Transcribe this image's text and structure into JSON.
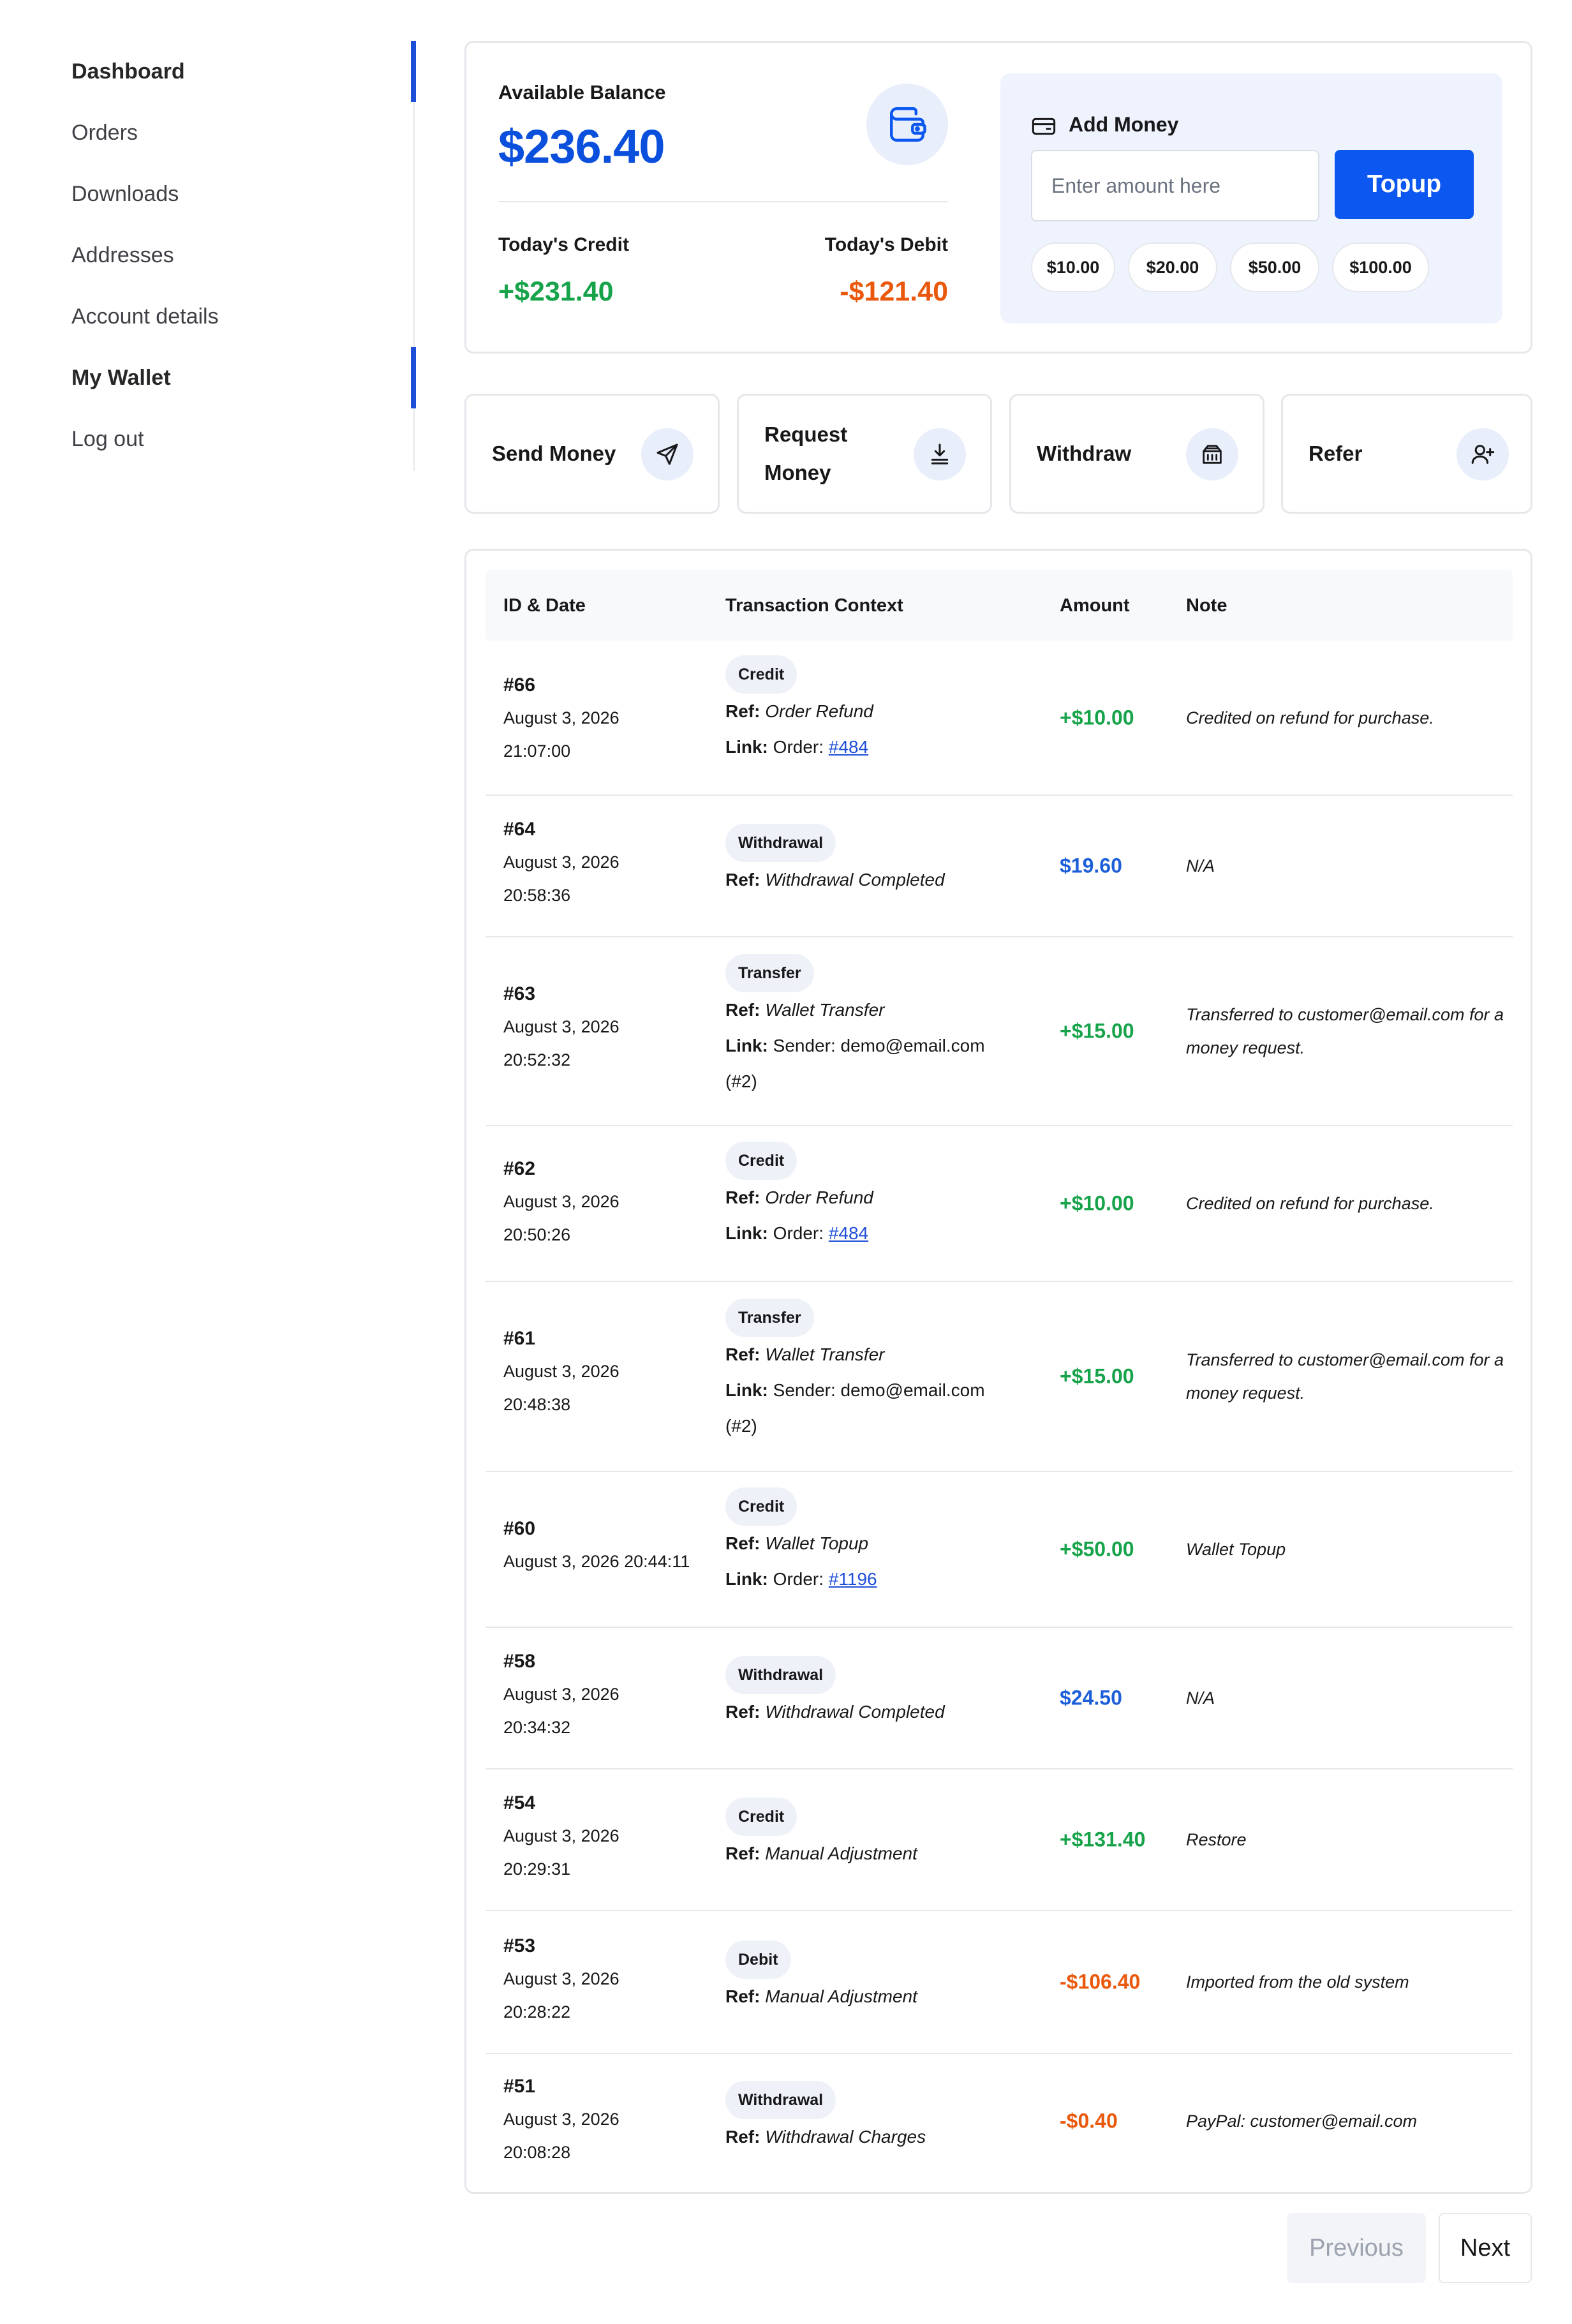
{
  "sidebar": {
    "items": [
      {
        "label": "Dashboard"
      },
      {
        "label": "Orders"
      },
      {
        "label": "Downloads"
      },
      {
        "label": "Addresses"
      },
      {
        "label": "Account details"
      },
      {
        "label": "My Wallet"
      },
      {
        "label": "Log out"
      }
    ]
  },
  "balance": {
    "label": "Available Balance",
    "amount": "$236.40",
    "credit_label": "Today's Credit",
    "credit_value": "+$231.40",
    "debit_label": "Today's Debit",
    "debit_value": "-$121.40",
    "icon": "wallet-icon"
  },
  "add_money": {
    "title": "Add Money",
    "placeholder": "Enter amount here",
    "value": "",
    "topup_label": "Topup",
    "presets": [
      "$10.00",
      "$20.00",
      "$50.00",
      "$100.00"
    ]
  },
  "actions": [
    {
      "label": "Send Money",
      "icon": "send-icon"
    },
    {
      "label": "Request Money",
      "icon": "download-icon"
    },
    {
      "label": "Withdraw",
      "icon": "bank-icon"
    },
    {
      "label": "Refer",
      "icon": "user-plus-icon"
    }
  ],
  "table": {
    "headers": [
      "ID & Date",
      "Transaction Context",
      "Amount",
      "Note"
    ],
    "rows": [
      {
        "id": "#66",
        "date": "August 3, 2026",
        "time": "21:07:00",
        "type": "Credit",
        "ref_label": "Ref:",
        "ref": "Order Refund",
        "link_label": "Link:",
        "link_prefix": "Order:",
        "link_text": "#484",
        "amount": "+$10.00",
        "note": "Credited on refund for purchase."
      },
      {
        "id": "#64",
        "date": "August 3, 2026",
        "time": "20:58:36",
        "type": "Withdrawal",
        "ref_label": "Ref:",
        "ref": "Withdrawal Completed",
        "amount": "$19.60",
        "note": "N/A"
      },
      {
        "id": "#63",
        "date": "August 3, 2026",
        "time": "20:52:32",
        "type": "Transfer",
        "ref_label": "Ref:",
        "ref": "Wallet Transfer",
        "link_label": "Link:",
        "link_prefix": "Sender: demo@email.com",
        "link_suffix": "(#2)",
        "amount": "+$15.00",
        "note": "Transferred to customer@email.com for a money request."
      },
      {
        "id": "#62",
        "date": "August 3, 2026",
        "time": "20:50:26",
        "type": "Credit",
        "ref_label": "Ref:",
        "ref": "Order Refund",
        "link_label": "Link:",
        "link_prefix": "Order:",
        "link_text": "#484",
        "amount": "+$10.00",
        "note": "Credited on refund for purchase."
      },
      {
        "id": "#61",
        "date": "August 3, 2026",
        "time": "20:48:38",
        "type": "Transfer",
        "ref_label": "Ref:",
        "ref": "Wallet Transfer",
        "link_label": "Link:",
        "link_prefix": "Sender: demo@email.com",
        "link_suffix": "(#2)",
        "amount": "+$15.00",
        "note": "Transferred to customer@email.com for a money request."
      },
      {
        "id": "#60",
        "date": "August 3, 2026 20:44:11",
        "time": "",
        "type": "Credit",
        "ref_label": "Ref:",
        "ref": "Wallet Topup",
        "link_label": "Link:",
        "link_prefix": "Order:",
        "link_text": "#1196",
        "amount": "+$50.00",
        "note": "Wallet Topup"
      },
      {
        "id": "#58",
        "date": "August 3, 2026",
        "time": "20:34:32",
        "type": "Withdrawal",
        "ref_label": "Ref:",
        "ref": "Withdrawal Completed",
        "amount": "$24.50",
        "note": "N/A"
      },
      {
        "id": "#54",
        "date": "August 3, 2026",
        "time": "20:29:31",
        "type": "Credit",
        "ref_label": "Ref:",
        "ref": "Manual Adjustment",
        "amount": "+$131.40",
        "note": "Restore"
      },
      {
        "id": "#53",
        "date": "August 3, 2026",
        "time": "20:28:22",
        "type": "Debit",
        "ref_label": "Ref:",
        "ref": "Manual Adjustment",
        "amount": "-$106.40",
        "note": "Imported from the old system"
      },
      {
        "id": "#51",
        "date": "August 3, 2026",
        "time": "20:08:28",
        "type": "Withdrawal",
        "ref_label": "Ref:",
        "ref": "Withdrawal Charges",
        "amount": "-$0.40",
        "note": "PayPal: customer@email.com"
      }
    ]
  },
  "pagination": {
    "previous_label": "Previous",
    "next_label": "Next"
  },
  "colors": {
    "accent": "#0b57f0",
    "credit": "#16a34a",
    "debit": "#ea580c",
    "neutral_amount": "#1d5fd8"
  }
}
